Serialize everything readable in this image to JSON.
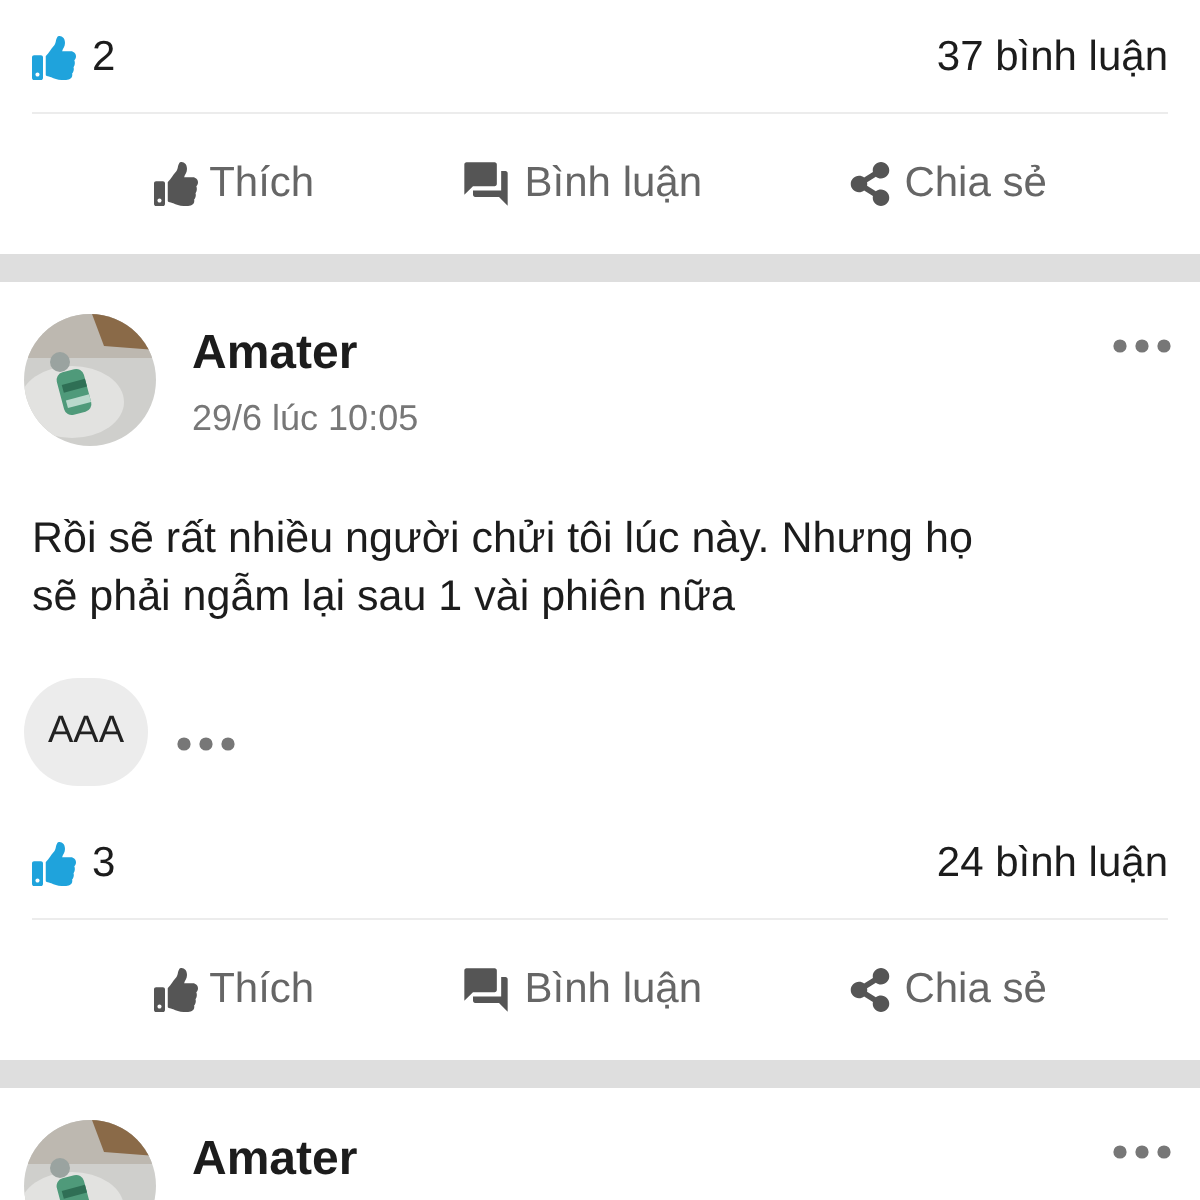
{
  "posts": [
    {
      "likes": "2",
      "comments": "37 bình luận",
      "actions": [
        {
          "kind": "like",
          "label": "Thích"
        },
        {
          "kind": "comment",
          "label": "Bình luận"
        },
        {
          "kind": "share",
          "label": "Chia sẻ"
        }
      ]
    },
    {
      "author": "Amater",
      "time": "29/6 lúc 10:05",
      "text": "Rồi sẽ rất nhiều người chửi tôi lúc này. Nhưng họ sẽ phải ngẫm lại sau 1 vài phiên nữa",
      "chips": [
        "AAA"
      ],
      "likes": "3",
      "comments": "24 bình luận",
      "actions": [
        {
          "kind": "like",
          "label": "Thích"
        },
        {
          "kind": "comment",
          "label": "Bình luận"
        },
        {
          "kind": "share",
          "label": "Chia sẻ"
        }
      ]
    },
    {
      "author": "Amater"
    }
  ]
}
